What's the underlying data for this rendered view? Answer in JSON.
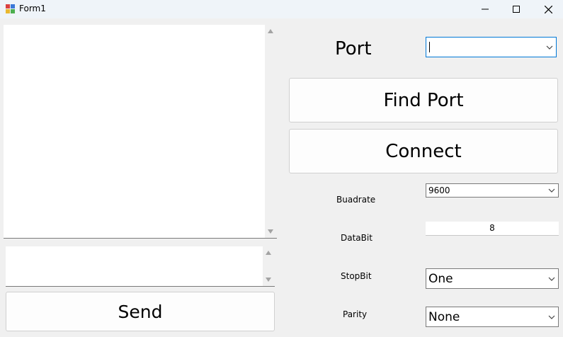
{
  "window": {
    "title": "Form1",
    "controls": [
      "minimize-icon",
      "maximize-icon",
      "close-icon"
    ]
  },
  "left": {
    "received_text": "",
    "send_text": "",
    "send_label": "Send"
  },
  "right": {
    "port_label": "Port",
    "port_value": "",
    "find_port_label": "Find Port",
    "connect_label": "Connect",
    "baudrate_label": "Buadrate",
    "baudrate_value": "9600",
    "databit_label": "DataBit",
    "databit_value": "8",
    "stopbit_label": "StopBit",
    "stopbit_value": "One",
    "parity_label": "Parity",
    "parity_value": "None"
  },
  "colors": {
    "titlebar": "#eff4f9",
    "form_background": "#f0f0f0",
    "focus_border": "#0078d7"
  }
}
